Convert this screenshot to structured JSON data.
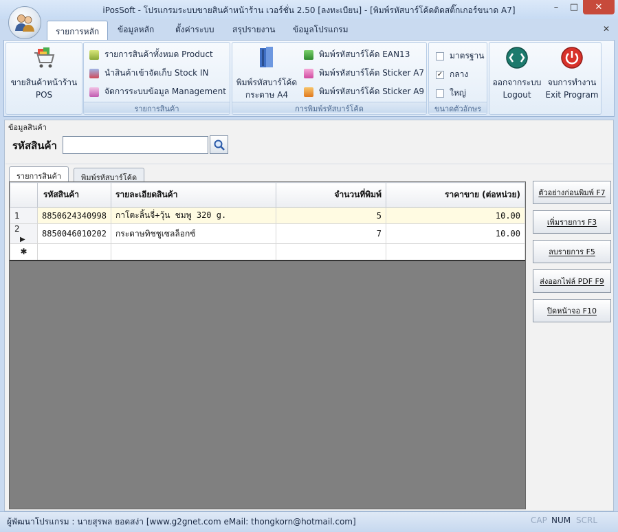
{
  "window": {
    "title": "iPosSoft - โปรแกรมระบบขายสินค้าหน้าร้าน เวอร์ชั่น 2.50 [ลงทะเบียน] - [พิมพ์รหัสบาร์โค้ดติดสติ๊กเกอร์ขนาด A7]",
    "minimize": "–",
    "maximize": "□",
    "close": "✕"
  },
  "ribbon_tabs": [
    "รายการหลัก",
    "ข้อมูลหลัก",
    "ตั้งค่าระบบ",
    "สรุปรายงาน",
    "ข้อมูลโปรแกรม"
  ],
  "ribbon_close": "✕",
  "ribbon": {
    "pos": {
      "label_line1": "ขายสินค้าหน้าร้าน",
      "label_line2": "POS"
    },
    "products_group": {
      "label": "รายการสินค้า",
      "items": [
        "รายการสินค้าทั้งหมด Product",
        "นำสินค้าเข้าจัดเก็บ Stock IN",
        "จัดการระบบข้อมูล Management"
      ]
    },
    "barcode_group": {
      "label": "การพิมพ์รหัสบาร์โค้ด",
      "a4_line1": "พิมพ์รหัสบาร์โค้ด",
      "a4_line2": "กระดาษ A4",
      "items": [
        "พิมพ์รหัสบาร์โค้ด EAN13",
        "พิมพ์รหัสบาร์โค้ด Sticker A7",
        "พิมพ์รหัสบาร์โค้ด Sticker A9"
      ]
    },
    "font_group": {
      "label": "ขนาดตัวอักษร",
      "options": [
        {
          "label": "มาตรฐาน",
          "checked": false
        },
        {
          "label": "กลาง",
          "checked": true
        },
        {
          "label": "ใหญ่",
          "checked": false
        }
      ]
    },
    "logout": {
      "line1": "ออกจากระบบ",
      "line2": "Logout"
    },
    "exit": {
      "line1": "จบการทำงาน",
      "line2": "Exit Program"
    }
  },
  "product_info": {
    "section_title": "ข้อมูลสินค้า",
    "code_label": "รหัสสินค้า",
    "code_value": ""
  },
  "subtabs": [
    "รายการสินค้า",
    "พิมพ์รหัสบาร์โค้ด"
  ],
  "grid": {
    "columns": [
      "รหัสสินค้า",
      "รายละเอียดสินค้า",
      "จำนวนที่พิมพ์",
      "ราคาขาย (ต่อหน่วย)"
    ],
    "rows": [
      {
        "row": "1",
        "code": "8850624340998",
        "detail": "กาโตะลิ้นจี่+วุ้น ชมพู 320 g.",
        "qty": "5",
        "price": "10.00"
      },
      {
        "row": "2",
        "code": "8850046010202",
        "detail": "กระดาษทิชชูเซลล็อกซ์",
        "qty": "7",
        "price": "10.00"
      }
    ],
    "new_row_marker": "✱",
    "current_row_marker": "▶"
  },
  "side_buttons": [
    "ตัวอย่างก่อนพิมพ์ F7",
    "เพิ่มรายการ F3",
    "ลบรายการ F5",
    "ส่งออกไฟล์ PDF F9",
    "ปิดหน้าจอ F10"
  ],
  "statusbar": {
    "credit": "ผู้พัฒนาโปรแกรม : นายสุรพล ยอดสง่า [www.g2gnet.com  eMail: thongkorn@hotmail.com]",
    "cap": "CAP",
    "num": "NUM",
    "scrl": "SCRL"
  }
}
